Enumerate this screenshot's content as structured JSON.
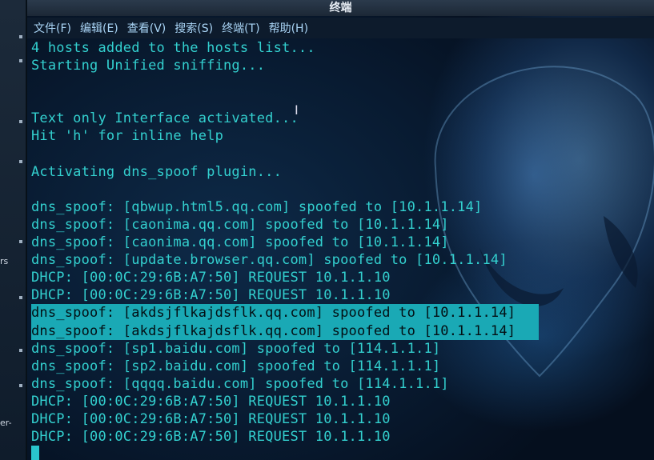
{
  "left_panel": {
    "fragments": [
      "rs",
      "er-"
    ]
  },
  "window": {
    "title": "终端"
  },
  "menu": {
    "items": [
      "文件(F)",
      "编辑(E)",
      "查看(V)",
      "搜索(S)",
      "终端(T)",
      "帮助(H)"
    ]
  },
  "terminal": {
    "lines": [
      "4 hosts added to the hosts list...",
      "Starting Unified sniffing...",
      "",
      "",
      "Text only Interface activated...",
      "Hit 'h' for inline help",
      "",
      "Activating dns_spoof plugin...",
      "",
      "dns_spoof: [qbwup.html5.qq.com] spoofed to [10.1.1.14]",
      "dns_spoof: [caonima.qq.com] spoofed to [10.1.1.14]",
      "dns_spoof: [caonima.qq.com] spoofed to [10.1.1.14]",
      "dns_spoof: [update.browser.qq.com] spoofed to [10.1.1.14]",
      "DHCP: [00:0C:29:6B:A7:50] REQUEST 10.1.1.10",
      "DHCP: [00:0C:29:6B:A7:50] REQUEST 10.1.1.10",
      "dns_spoof: [akdsjflkajdsflk.qq.com] spoofed to [10.1.1.14]",
      "dns_spoof: [akdsjflkajdsflk.qq.com] spoofed to [10.1.1.14]",
      "dns_spoof: [sp1.baidu.com] spoofed to [114.1.1.1]",
      "dns_spoof: [sp2.baidu.com] spoofed to [114.1.1.1]",
      "dns_spoof: [qqqq.baidu.com] spoofed to [114.1.1.1]",
      "DHCP: [00:0C:29:6B:A7:50] REQUEST 10.1.1.10",
      "DHCP: [00:0C:29:6B:A7:50] REQUEST 10.1.1.10",
      "DHCP: [00:0C:29:6B:A7:50] REQUEST 10.1.1.10"
    ],
    "highlighted_line_indexes": [
      15,
      16
    ],
    "text_color": "#33d0cf",
    "highlight_color": "#1aa9b5"
  }
}
